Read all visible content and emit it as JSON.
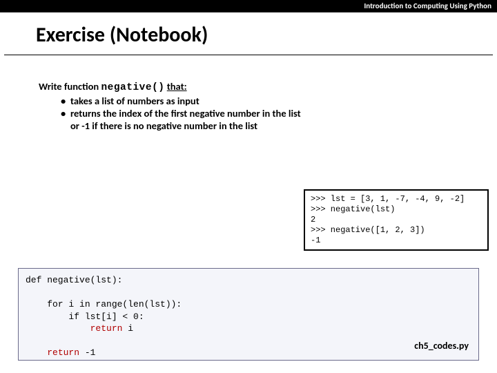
{
  "header": {
    "course": "Introduction to Computing Using Python"
  },
  "title": "Exercise (Notebook)",
  "task": {
    "intro_prefix": "Write function ",
    "func_name": "negative()",
    "intro_suffix_word": "that:",
    "bullets": [
      "takes a list of numbers as input",
      "returns the index of the first negative number in the list",
      "or -1 if there is no negative number in the list"
    ]
  },
  "example": {
    "lines": [
      ">>> lst = [3, 1, -7, -4, 9, -2]",
      ">>> negative(lst)",
      "2",
      ">>> negative([1, 2, 3])",
      "-1"
    ]
  },
  "solution": {
    "def_line": "def negative(lst):",
    "for_line": "    for i in range(len(lst)):",
    "if_line": "        if lst[i] < 0:",
    "inner_return_indent": "            ",
    "inner_return_kw": "return",
    "inner_return_rest": " i",
    "outer_return_indent": "    ",
    "outer_return_kw": "return",
    "outer_return_rest": " -1",
    "filename": "ch5_codes.py"
  }
}
